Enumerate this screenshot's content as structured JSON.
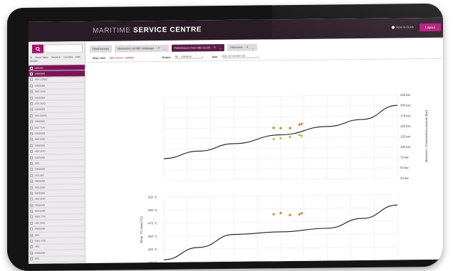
{
  "app": {
    "brand_light": "MARITIME",
    "brand_bold": "SERVICE CENTRE",
    "how_to": "How-to-Guide",
    "logout": "Logout"
  },
  "sidebar": {
    "search_icon": "search-icon",
    "columns": [
      "IA",
      "Vessel Name",
      "Vessel ID",
      "Favorites",
      "IMO Number"
    ],
    "vessels": [
      {
        "name": "SEE2GI",
        "active": true
      },
      {
        "name": "00000000",
        "active": true
      },
      {
        "name": "SEE C0ABC",
        "active": false
      },
      {
        "name": "00000000",
        "active": false
      },
      {
        "name": "SEE X03S",
        "active": false
      },
      {
        "name": "00000000",
        "active": false
      },
      {
        "name": "SEE X003",
        "active": false
      },
      {
        "name": "00000000",
        "active": false
      },
      {
        "name": "SEE 0400S",
        "active": false
      },
      {
        "name": "00000000",
        "active": false
      },
      {
        "name": "SEE TUN",
        "active": false
      },
      {
        "name": "00000000",
        "active": false
      },
      {
        "name": "SEE 0000",
        "active": false
      },
      {
        "name": "00000000",
        "active": false
      },
      {
        "name": "SEE 0000",
        "active": false
      },
      {
        "name": "00000000",
        "active": false
      },
      {
        "name": "SEE",
        "active": false
      },
      {
        "name": "00000000",
        "active": false
      },
      {
        "name": "SEE 0B0",
        "active": false
      },
      {
        "name": "00000000",
        "active": false
      },
      {
        "name": "SEE 0000",
        "active": false
      },
      {
        "name": "00000000",
        "active": false
      },
      {
        "name": "SEE 0000",
        "active": false
      },
      {
        "name": "00000000",
        "active": false
      },
      {
        "name": "SEE 0000",
        "active": false
      },
      {
        "name": "0000 7700",
        "active": false
      },
      {
        "name": "SEE 0000",
        "active": false
      },
      {
        "name": "00000000",
        "active": false
      },
      {
        "name": "SEE",
        "active": false
      },
      {
        "name": "0000 7700",
        "active": false
      },
      {
        "name": "SEE",
        "active": false
      },
      {
        "name": "00000000",
        "active": false
      },
      {
        "name": "SEE",
        "active": false
      },
      {
        "name": "00000000",
        "active": false
      }
    ]
  },
  "tabs": [
    {
      "label": "FleetOverview",
      "active": false,
      "closable": false
    },
    {
      "label": "Mariner/Ind.cult 0BE Vitollsteger",
      "active": false,
      "closable": true
    },
    {
      "label": "Performance Chart: 0BE Su120",
      "active": true,
      "closable": true
    },
    {
      "label": "SSI/Frame",
      "active": false,
      "closable": true
    }
  ],
  "filters": {
    "ship_label": "Ship / Item",
    "ship_value": "0BE Vessel - 000000",
    "engine_label": "Engine",
    "engine_value": "NE - Individual",
    "date_label": "Date",
    "date_value": "2021-10-15/2021-06"
  },
  "chart_data": [
    {
      "type": "line",
      "ylabel": "Maximum / Compression pressure [bar]",
      "y_ticks": [
        "225 bar",
        "200 bar",
        "175 bar",
        "150 bar",
        "125 bar",
        "100 bar",
        "75 bar",
        "50 bar",
        "25 bar"
      ],
      "ylim": [
        25,
        225
      ],
      "series": [
        {
          "values_x": [
            0,
            15,
            30,
            50,
            70,
            85,
            100
          ],
          "values_y": [
            78,
            95,
            112,
            132,
            151,
            167,
            200
          ]
        }
      ],
      "points": [
        {
          "x": 47,
          "y": 149,
          "color": "#e07a1f"
        },
        {
          "x": 50,
          "y": 148,
          "color": "#e07a1f"
        },
        {
          "x": 54,
          "y": 148,
          "color": "#e07a1f"
        },
        {
          "x": 58,
          "y": 156,
          "color": "#e07a1f"
        },
        {
          "x": 59,
          "y": 158,
          "color": "#e07a1f"
        },
        {
          "x": 47,
          "y": 122,
          "color": "#9ccc3a"
        },
        {
          "x": 50,
          "y": 124,
          "color": "#9ccc3a"
        },
        {
          "x": 54,
          "y": 127,
          "color": "#9ccc3a"
        },
        {
          "x": 58,
          "y": 131,
          "color": "#9ccc3a"
        },
        {
          "x": 59,
          "y": 129,
          "color": "#9ccc3a"
        }
      ]
    },
    {
      "type": "line",
      "ylabel": "Temp. TC down [°C]",
      "y_ticks": [
        "525 °C",
        "500 °C",
        "475 °C",
        "450 °C",
        "425 °C",
        "400 °C"
      ],
      "ylim": [
        400,
        525
      ],
      "series": [
        {
          "values_x": [
            0,
            15,
            30,
            50,
            70,
            85,
            100
          ],
          "values_y": [
            405,
            428,
            452,
            456,
            462,
            480,
            505
          ]
        }
      ],
      "points": [
        {
          "x": 47,
          "y": 490,
          "color": "#e07a1f"
        },
        {
          "x": 50,
          "y": 492,
          "color": "#e07a1f"
        },
        {
          "x": 54,
          "y": 488,
          "color": "#e07a1f"
        },
        {
          "x": 58,
          "y": 489,
          "color": "#e07a1f"
        },
        {
          "x": 59,
          "y": 491,
          "color": "#e07a1f"
        }
      ]
    }
  ]
}
